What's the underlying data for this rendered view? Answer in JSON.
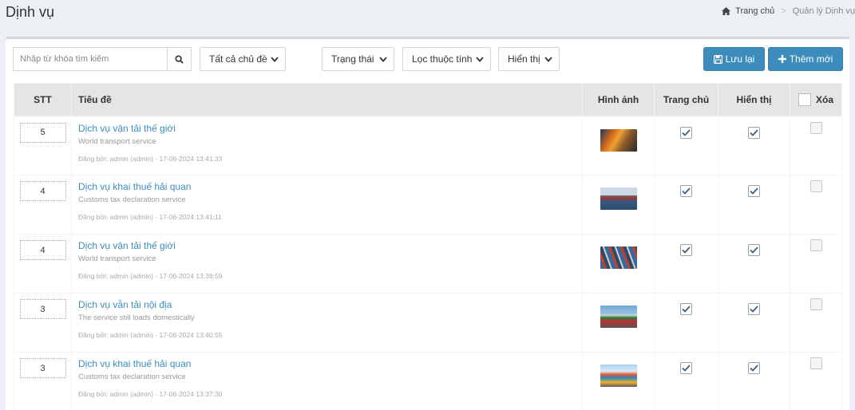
{
  "page": {
    "title": "Dịnh vụ"
  },
  "breadcrumb": {
    "home": "Trang chủ",
    "separator": ">",
    "current": "Quản lý Dịnh vụ"
  },
  "toolbar": {
    "search_placeholder": "Nhập từ khóa tìm kiếm",
    "topic_select": "Tất cả chủ đề",
    "status_select": "Trạng thái",
    "attribute_select": "Lọc thuộc tính",
    "display_select": "Hiển thị",
    "save_label": "Lưu lại",
    "add_label": "Thêm mới"
  },
  "table": {
    "headers": {
      "stt": "STT",
      "title": "Tiêu đề",
      "image": "Hình ảnh",
      "home": "Trang chủ",
      "display": "Hiển thị",
      "delete": "Xóa"
    },
    "rows": [
      {
        "stt": "5",
        "title": "Dịch vụ vận tải thế giới",
        "subtitle": "World transport service",
        "meta": "Đăng bởi: admin (admin) - 17-06-2024 13:41:33",
        "home": true,
        "display": true,
        "delete": false
      },
      {
        "stt": "4",
        "title": "Dịch vụ khai thuế hải quan",
        "subtitle": "Customs tax declaration service",
        "meta": "Đăng bởi: admin (admin) - 17-06-2024 13:41:11",
        "home": true,
        "display": true,
        "delete": false
      },
      {
        "stt": "4",
        "title": "Dịch vụ vận tải thế giới",
        "subtitle": "World transport service",
        "meta": "Đăng bởi: admin (admin) - 17-06-2024 13:38:59",
        "home": true,
        "display": true,
        "delete": false
      },
      {
        "stt": "3",
        "title": "Dịch vụ vẫn tải nội địa",
        "subtitle": "The service still loads domestically",
        "meta": "Đăng bởi: admin (admin) - 17-06-2024 13:40:55",
        "home": true,
        "display": true,
        "delete": false
      },
      {
        "stt": "3",
        "title": "Dịch vụ khai thuế hải quan",
        "subtitle": "Customs tax declaration service",
        "meta": "Đăng bởi: admin (admin) - 17-06-2024 13:37:30",
        "home": true,
        "display": true,
        "delete": false
      }
    ]
  },
  "colors": {
    "accent": "#3c8dbc",
    "header_bg": "#e5e5e5",
    "page_bg": "#ecf0f5"
  },
  "icons": {
    "home": "home-icon",
    "search": "search-icon",
    "save": "floppy-icon",
    "add": "plus-icon",
    "caret": "chevron-down-icon",
    "check": "check-icon"
  }
}
